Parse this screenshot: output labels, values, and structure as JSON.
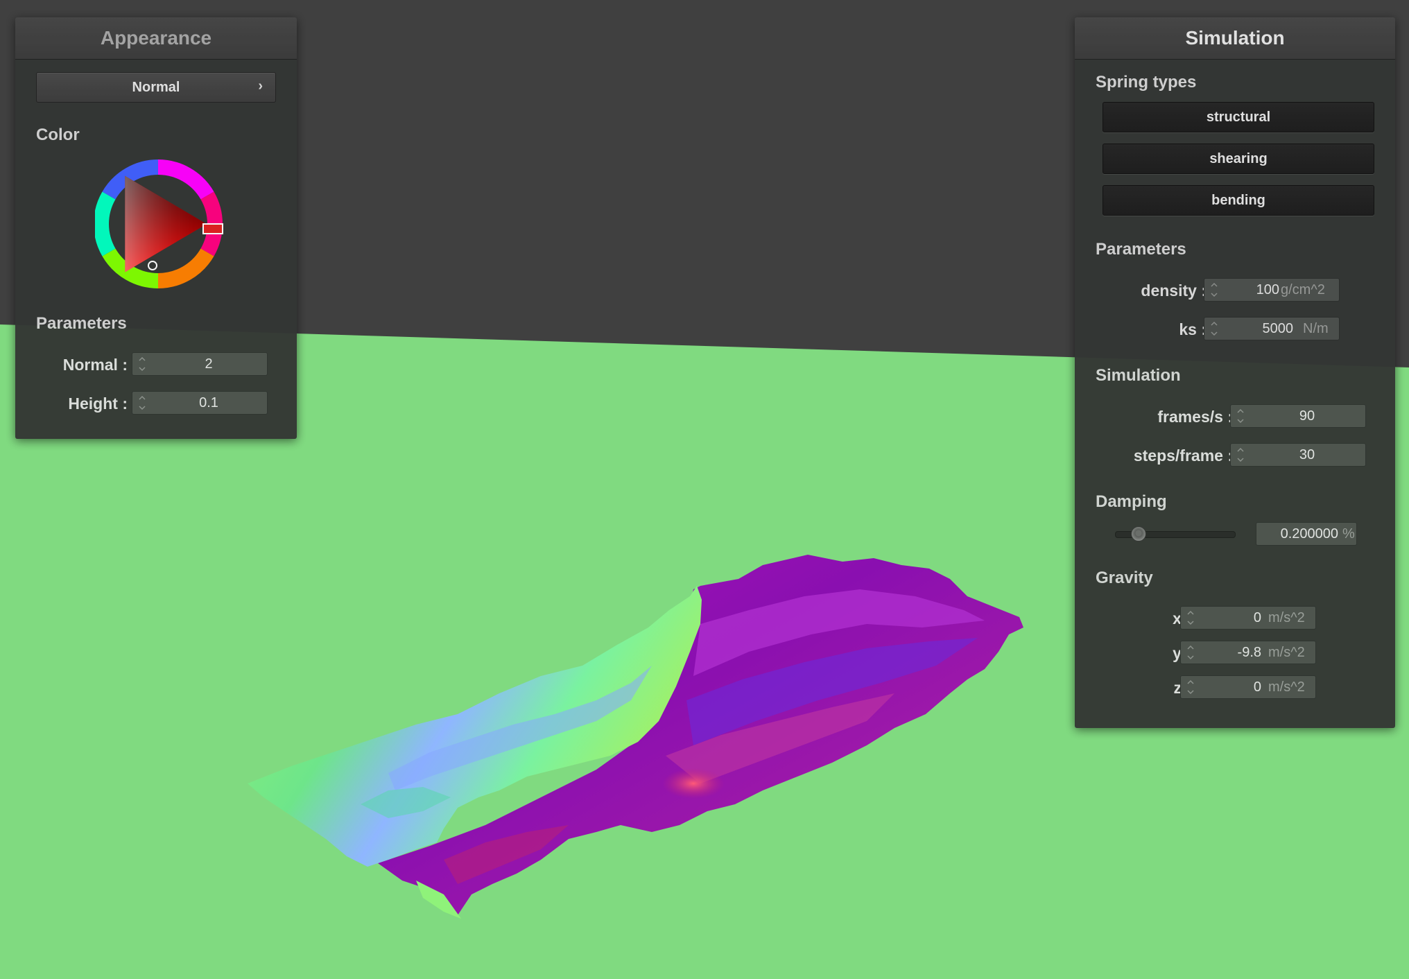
{
  "appearance": {
    "title": "Appearance",
    "shader_select": "Normal",
    "color_label": "Color",
    "color_wheel": {
      "hue_color": "#ff0000"
    },
    "parameters_label": "Parameters",
    "normal_label": "Normal :",
    "normal_value": "2",
    "height_label": "Height :",
    "height_value": "0.1"
  },
  "simulation": {
    "title": "Simulation",
    "spring_types_label": "Spring types",
    "spring_buttons": [
      "structural",
      "shearing",
      "bending"
    ],
    "parameters_label": "Parameters",
    "density_label": "density :",
    "density_value": "100",
    "density_unit": "g/cm^2",
    "ks_label": "ks :",
    "ks_value": "5000",
    "ks_unit": "N/m",
    "simulation_label": "Simulation",
    "fps_label": "frames/s :",
    "fps_value": "90",
    "steps_label": "steps/frame :",
    "steps_value": "30",
    "damping_label": "Damping",
    "damping_slider_fraction": 0.2,
    "damping_value": "0.200000",
    "damping_unit": "%",
    "gravity_label": "Gravity",
    "gx_label": "x :",
    "gx_value": "0",
    "gy_label": "y :",
    "gy_value": "-9.8",
    "gz_label": "z :",
    "gz_value": "0",
    "gravity_unit": "m/s^2"
  },
  "scene": {
    "background_color": "#404040",
    "ground_color": "#80da80",
    "cloth_colors": [
      "#8a10b0",
      "#88f070"
    ]
  }
}
